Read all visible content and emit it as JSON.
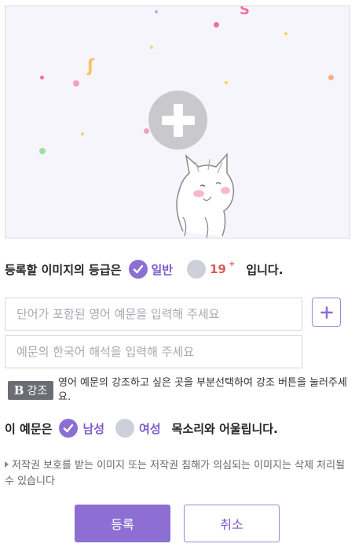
{
  "image_upload": {
    "icon": "plus-icon",
    "illustration": "cat-illustration"
  },
  "grade": {
    "prefix": "등록할 이미지의 등급은",
    "option_general": "일반",
    "option_adult": "19",
    "option_adult_sup": "+",
    "suffix": "입니다.",
    "selected": "일반"
  },
  "form": {
    "english_placeholder": "단어가 포함된 영어 예문을 입력해 주세요",
    "english_value": "",
    "korean_placeholder": "예문의 한국어 해석을 입력해 주세요",
    "korean_value": "",
    "add_icon": "plus-icon"
  },
  "emphasis": {
    "button_b": "B",
    "button_label": "강조",
    "help_text": "영어 예문의 강조하고 싶은 곳을 부분선택하여 강조 버튼을 눌러주세요."
  },
  "voice": {
    "prefix": "이 예문은",
    "option_male": "남성",
    "option_female": "여성",
    "suffix": "목소리와 어울립니다.",
    "selected": "남성"
  },
  "notice": {
    "text": "저작권 보호를 받는 이미지 또는 저작권 침해가 의심되는 이미지는 삭제 처리될 수 있습니다"
  },
  "buttons": {
    "submit": "등록",
    "cancel": "취소"
  },
  "colors": {
    "accent": "#8d6fd3",
    "accent_text": "#7a5bc8",
    "adult": "#e05757",
    "unselected": "#cdd0d8"
  }
}
